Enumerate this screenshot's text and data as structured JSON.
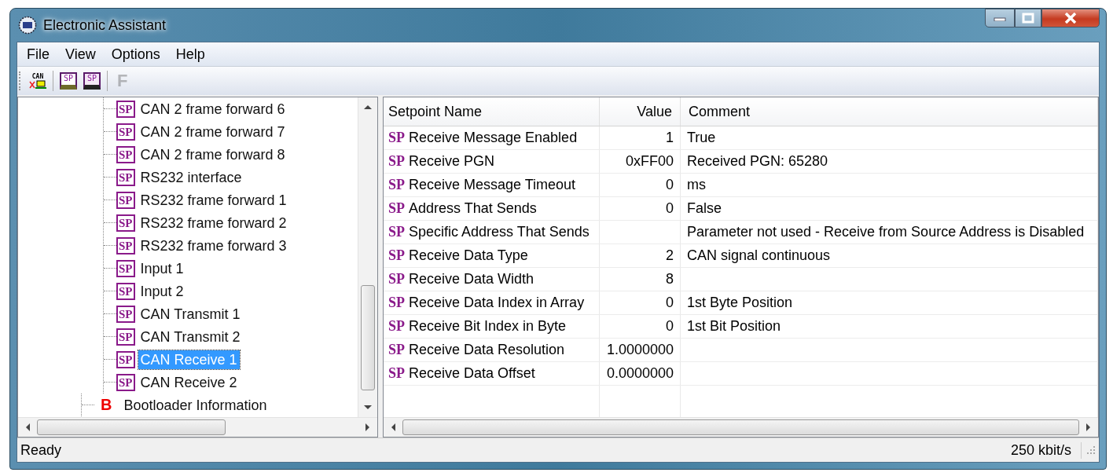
{
  "window": {
    "title": "Electronic Assistant"
  },
  "menu": [
    "File",
    "View",
    "Options",
    "Help"
  ],
  "toolbar": [
    {
      "kind": "connect",
      "label": "CAN",
      "disabled": false
    },
    {
      "kind": "open",
      "label": "SP",
      "disabled": false
    },
    {
      "kind": "save",
      "label": "SP",
      "disabled": false
    },
    {
      "kind": "letter",
      "label": "F",
      "disabled": true
    }
  ],
  "tree": [
    {
      "children": [
        {
          "badge": "SP",
          "label": "CAN 2 frame forward 6",
          "selected": false
        },
        {
          "badge": "SP",
          "label": "CAN 2 frame forward 7",
          "selected": false
        },
        {
          "badge": "SP",
          "label": "CAN 2 frame forward 8",
          "selected": false
        },
        {
          "badge": "SP",
          "label": "RS232 interface",
          "selected": false
        },
        {
          "badge": "SP",
          "label": "RS232 frame forward 1",
          "selected": false
        },
        {
          "badge": "SP",
          "label": "RS232 frame forward 2",
          "selected": false
        },
        {
          "badge": "SP",
          "label": "RS232 frame forward 3",
          "selected": false
        },
        {
          "badge": "SP",
          "label": "Input 1",
          "selected": false
        },
        {
          "badge": "SP",
          "label": "Input 2",
          "selected": false
        },
        {
          "badge": "SP",
          "label": "CAN Transmit 1",
          "selected": false
        },
        {
          "badge": "SP",
          "label": "CAN Transmit 2",
          "selected": false
        },
        {
          "badge": "SP",
          "label": "CAN Receive 1",
          "selected": true
        },
        {
          "badge": "SP",
          "label": "CAN Receive 2",
          "selected": false
        }
      ]
    },
    {
      "badge": "B",
      "label": "Bootloader Information",
      "selected": false
    }
  ],
  "table": {
    "columns": [
      "Setpoint Name",
      "Value",
      "Comment"
    ],
    "rows": [
      {
        "badge": "SP",
        "name": "Receive Message Enabled",
        "value": "1",
        "comment": "True"
      },
      {
        "badge": "SP",
        "name": "Receive PGN",
        "value": "0xFF00",
        "comment": "Received PGN: 65280"
      },
      {
        "badge": "SP",
        "name": "Receive Message Timeout",
        "value": "0",
        "comment": "ms"
      },
      {
        "badge": "SP",
        "name": "Address That Sends",
        "value": "0",
        "comment": "False"
      },
      {
        "badge": "SP",
        "name": "Specific Address That Sends",
        "value": "",
        "comment": "Parameter not used - Receive from Source Address is Disabled"
      },
      {
        "badge": "SP",
        "name": "Receive Data Type",
        "value": "2",
        "comment": "CAN signal continuous"
      },
      {
        "badge": "SP",
        "name": "Receive Data Width",
        "value": "8",
        "comment": ""
      },
      {
        "badge": "SP",
        "name": "Receive Data Index in Array",
        "value": "0",
        "comment": "1st Byte Position"
      },
      {
        "badge": "SP",
        "name": "Receive Bit Index in Byte",
        "value": "0",
        "comment": "1st Bit Position"
      },
      {
        "badge": "SP",
        "name": "Receive Data Resolution",
        "value": "1.0000000",
        "comment": ""
      },
      {
        "badge": "SP",
        "name": "Receive Data Offset",
        "value": "0.0000000",
        "comment": ""
      }
    ]
  },
  "status_bar": {
    "message": "Ready",
    "speed": "250 kbit/s"
  }
}
